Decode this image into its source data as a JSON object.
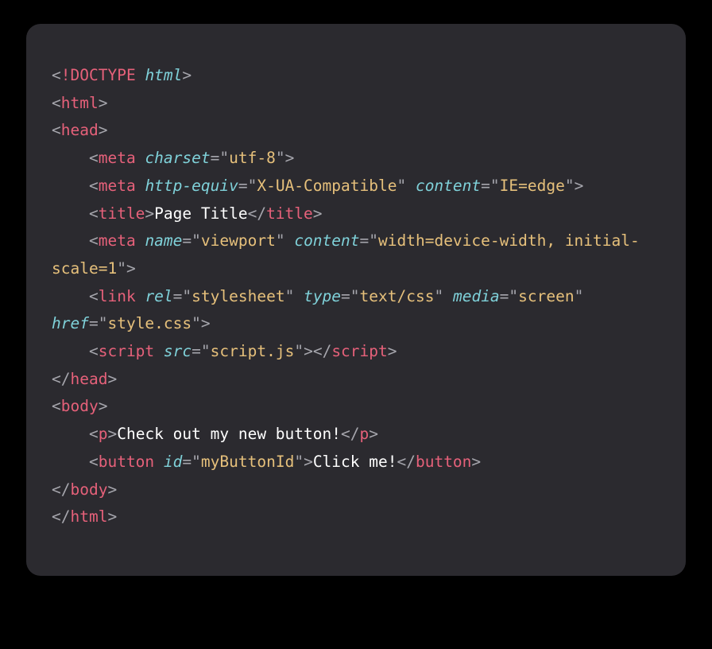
{
  "code": {
    "doctype_bang": "!",
    "doctype_word": "DOCTYPE",
    "doctype_arg": "html",
    "tag_html": "html",
    "tag_head": "head",
    "tag_meta": "meta",
    "tag_title": "title",
    "tag_link": "link",
    "tag_script": "script",
    "tag_body": "body",
    "tag_p": "p",
    "tag_button": "button",
    "attr_charset": "charset",
    "attr_http_equiv": "http-equiv",
    "attr_content": "content",
    "attr_name": "name",
    "attr_rel": "rel",
    "attr_type": "type",
    "attr_media": "media",
    "attr_href": "href",
    "attr_src": "src",
    "attr_id": "id",
    "val_utf8": "utf-8",
    "val_xua": "X-UA-Compatible",
    "val_ieedge": "IE=edge",
    "val_viewport": "viewport",
    "val_viewport_content": "width=device-width, initial-scale=1",
    "val_stylesheet": "stylesheet",
    "val_textcss": "text/css",
    "val_screen": "screen",
    "val_stylecss": "style.css",
    "val_scriptjs": "script.js",
    "val_mybuttonid": "myButtonId",
    "text_title": "Page Title",
    "text_p": "Check out my new button!",
    "text_button": "Click me!",
    "indent": "    "
  }
}
